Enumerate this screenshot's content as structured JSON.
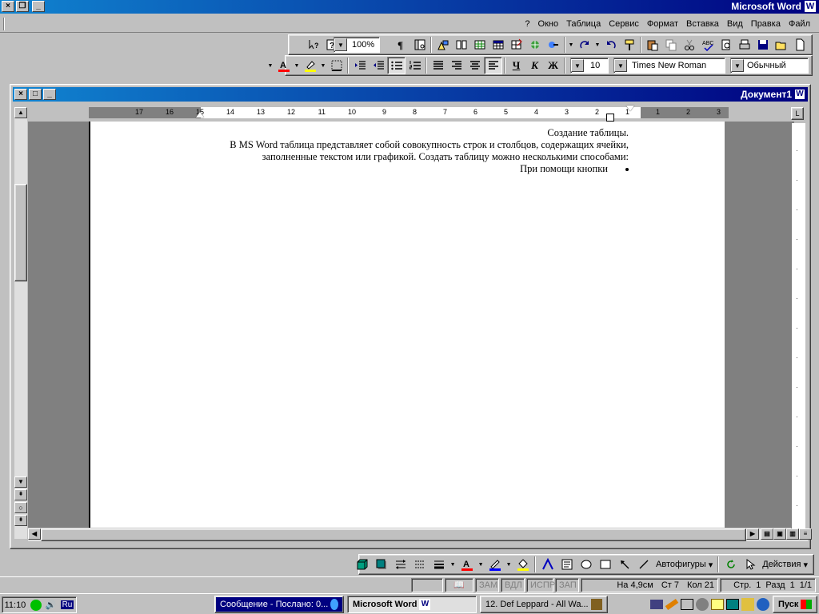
{
  "app": {
    "title": "Microsoft Word",
    "menu": [
      "Файл",
      "Правка",
      "Вид",
      "Вставка",
      "Формат",
      "Сервис",
      "Таблица",
      "Окно",
      "?"
    ]
  },
  "toolbar_standard": {
    "zoom": "100%",
    "icons": [
      "new-document-icon",
      "open-folder-icon",
      "save-icon",
      "print-icon",
      "print-preview-icon",
      "spelling-icon",
      "cut-icon",
      "copy-icon",
      "paste-icon",
      "format-painter-icon",
      "undo-icon",
      "redo-icon",
      "hyperlink-icon",
      "web-toolbar-icon",
      "tables-borders-icon",
      "insert-table-icon",
      "insert-excel-icon",
      "columns-icon",
      "drawing-icon",
      "document-map-icon",
      "show-formatting-icon",
      "help-icon"
    ]
  },
  "toolbar_formatting": {
    "style": "Обычный",
    "font": "Times New Roman",
    "size": "10",
    "bold": "Ж",
    "italic": "К",
    "underline": "Ч"
  },
  "document": {
    "title": "Документ1",
    "lines": [
      "Создание таблицы.",
      "В MS Word таблица представляет собой совокупность строк и столбцов, содержащих ячейки,",
      "заполненные текстом или графикой. Создать таблицу можно несколькими способами:"
    ],
    "bullet": "При помощи кнопки",
    "ruler_numbers": [
      "3",
      "2",
      "1",
      "1",
      "2",
      "3",
      "4",
      "5",
      "6",
      "7",
      "8",
      "9",
      "10",
      "11",
      "12",
      "13",
      "14",
      "15",
      "16",
      "17"
    ]
  },
  "drawing_toolbar": {
    "actions": "Действия",
    "autoshapes": "Автофигуры"
  },
  "statusbar": {
    "page": "Стр.",
    "page_num": "1",
    "section": "Разд",
    "section_num": "1",
    "pages": "1/1",
    "position": "На 4,9см",
    "line": "Ст 7",
    "column": "Кол 21",
    "rec": "ЗАП",
    "track": "ИСПР",
    "ext": "ВДЛ",
    "ovr": "ЗАМ"
  },
  "taskbar": {
    "start": "Пуск",
    "tasks": [
      "12. Def Leppard - All Wa...",
      "Microsoft Word",
      "Сообщение - Послано: 0..."
    ],
    "lang": "Ru",
    "time": "11:10"
  }
}
